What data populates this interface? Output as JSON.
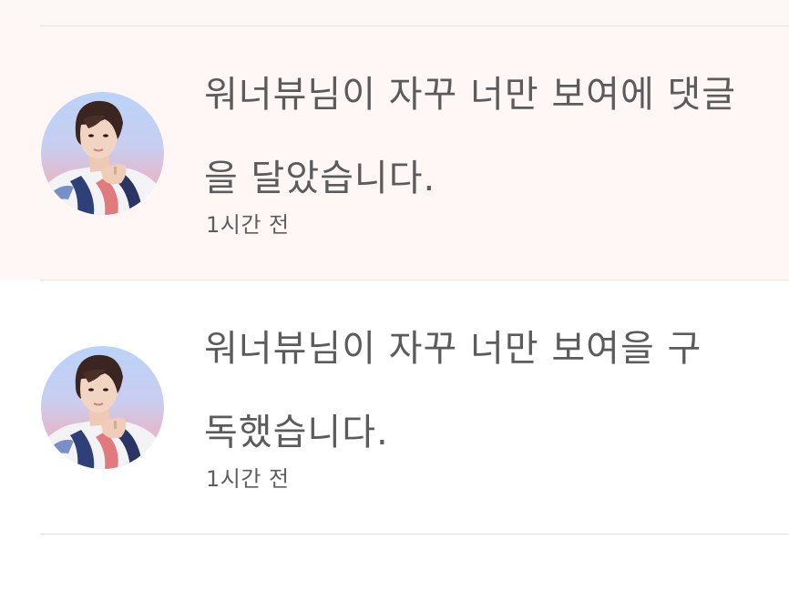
{
  "notifications": [
    {
      "message": "워너뷰님이 자꾸 너만 보여에 댓글을 달았습니다.",
      "time": "1시간 전",
      "state": "unread",
      "avatar_icon": "user-avatar-photo"
    },
    {
      "message": "워너뷰님이 자꾸 너만 보여을 구독했습니다.",
      "time": "1시간 전",
      "state": "read",
      "avatar_icon": "user-avatar-photo"
    }
  ],
  "colors": {
    "unread_background": "#fff7f5",
    "read_background": "#ffffff",
    "text": "#5b5b5b",
    "divider": "#e6e2e0"
  }
}
